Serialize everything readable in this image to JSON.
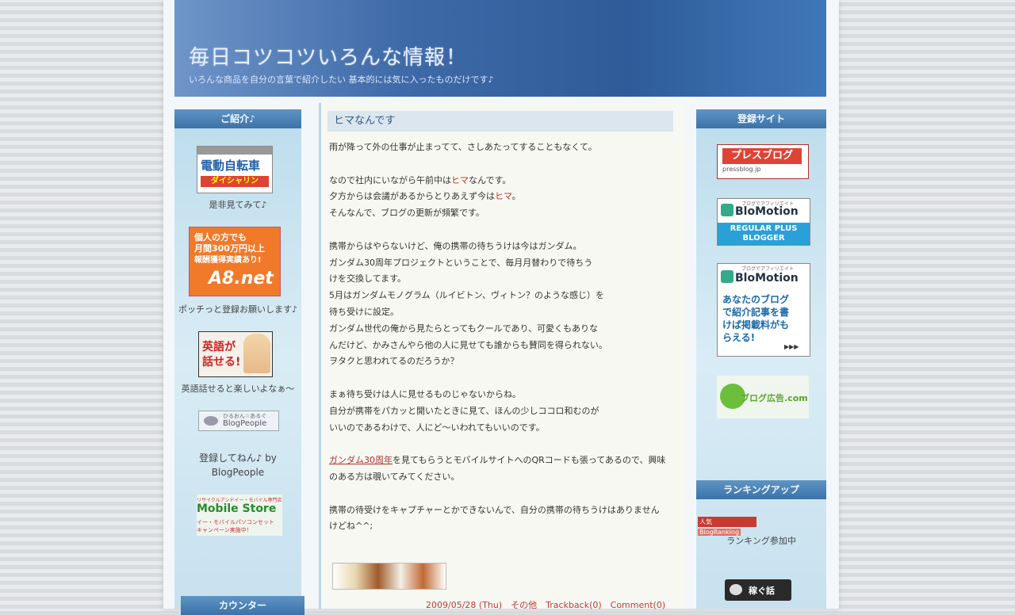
{
  "header": {
    "title": "毎日コツコツいろんな情報！",
    "subtitle": "いろんな商品を自分の言葉で紹介したい 基本的には気に入ったものだけです♪"
  },
  "left_sidebar": {
    "heading": "ご紹介♪",
    "items": [
      {
        "banner_line1": "電動自転車",
        "banner_line2": "ダイシャリン",
        "caption": "是非見てみて♪"
      },
      {
        "banner_line1": "個人の方でも",
        "banner_line2": "月間300万円以上",
        "banner_line3": "報酬獲得実績あり!",
        "banner_brand": "A8.net",
        "caption": "ポッチっと登録お願いします♪"
      },
      {
        "banner_line1": "英語が",
        "banner_line2": "話せる!",
        "caption": "英語話せると楽しいよなぁ～"
      },
      {
        "banner_small": "ひるおん☆あるぐ",
        "banner_brand": "BlogPeople",
        "caption_line1": "登録してねん♪ by",
        "caption_line2": "BlogPeople"
      },
      {
        "banner_small": "リサイクルアンドイー・モバイル専門店",
        "banner_brand": "Mobile Store",
        "banner_line1": "イー・モバイルパソコンセット",
        "banner_line2": "キャンペーン実施中！"
      }
    ],
    "counter_heading": "カウンター"
  },
  "post": {
    "title": "ヒマなんです",
    "p1": "雨が降って外の仕事が止まってて、さしあたってすることもなくて。",
    "p2a_pre": "なので社内にいながら午前中は",
    "p2a_red": "ヒマ",
    "p2a_post": "なんです。",
    "p2b_pre": "夕方からは会議があるからとりあえず今は",
    "p2b_red": "ヒマ",
    "p2b_post": "。",
    "p2c": "そんなんで、ブログの更新が頻繁です。",
    "p3": [
      "携帯からはやらないけど、俺の携帯の待ちうけは今はガンダム。",
      "ガンダム30周年プロジェクトということで、毎月月替わりで待ちう",
      "けを交換してます。",
      "5月はガンダムモノグラム（ルイビトン、ヴィトン？のような感じ）を",
      "待ち受けに設定。",
      "ガンダム世代の俺から見たらとってもクールであり、可愛くもありな",
      "んだけど、かみさんやら他の人に見せても誰からも賛同を得られない。",
      "ヲタクと思われてるのだろうか？"
    ],
    "p4": [
      "まぁ待ち受けは人に見せるものじゃないからね。",
      "自分が携帯をパカッと開いたときに見て、ほんの少しココロ和むのが",
      "いいのであるわけで、人にど～いわれてもいいのです。"
    ],
    "p5_link": "ガンダム30周年",
    "p5_rest": "を見てもらうとモバイルサイトへのQRコードも張ってあるので、興味",
    "p5_line2": "のある方は覗いてみてください。",
    "p6_line1": "携帯の待受けをキャプチャーとかできないんで、自分の携帯の待ちうけはありません",
    "p6_line2": "けどね^^;",
    "footer": "2009/05/28 (Thu)　その他　Trackback(0)　Comment(0)"
  },
  "right_sidebar": {
    "heading": "登録サイト",
    "pressblog": {
      "name": "プレスブログ",
      "url_text": "pressblog.jp"
    },
    "biomotion1": {
      "tagline": "ブログでアフィリエイト",
      "brand": "BloMotion",
      "line1": "REGULAR PLUS",
      "line2": "BLOGGER"
    },
    "biomotion2": {
      "tagline": "ブログでアフィリエイト",
      "brand": "BloMotion",
      "line1": "あなたのブログ",
      "line2": "で紹介記事を書",
      "line3": "けば掲載料がも",
      "line4": "らえる!",
      "arrows": "▶▶▶"
    },
    "blogkoukoku": {
      "text": "ブログ広告.com"
    },
    "ranking_heading": "ランキングアップ",
    "ranking_badge_left": "人気",
    "ranking_badge_right": "BlogRanking",
    "ranking_caption": "ランキング参加中",
    "kasegu": "稼ぐ話"
  },
  "colors": {
    "header_blue": "#3e6aa8",
    "sidebar_bg": "#c7e1ee",
    "accent_red": "#c0302a"
  }
}
